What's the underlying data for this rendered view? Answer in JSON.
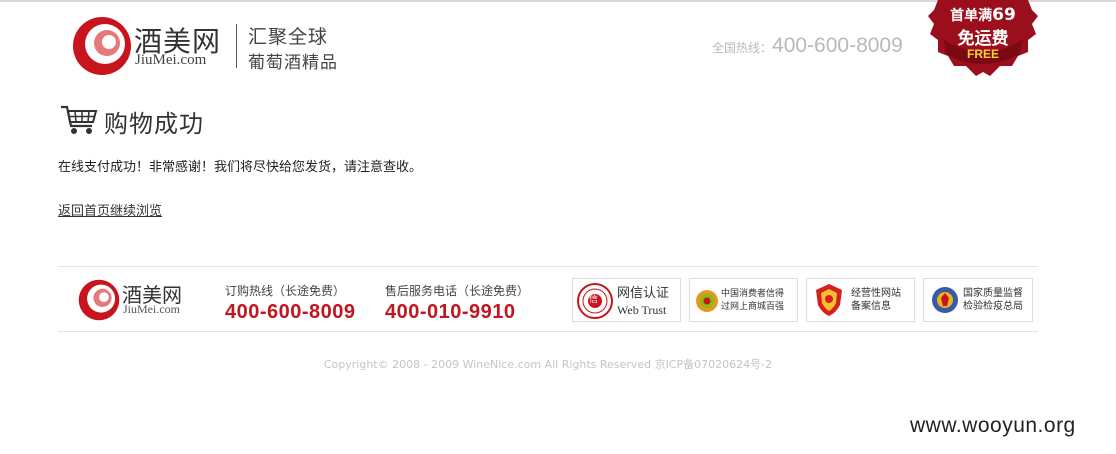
{
  "header": {
    "logo_cn": "酒美网",
    "logo_en": "JiuMei.com",
    "slogan_line1": "汇聚全球",
    "slogan_line2": "葡萄酒精品",
    "hotline_label": "全国热线：",
    "hotline_number": "400-600-8009",
    "badge": {
      "prefix": "首单满",
      "amount": "69",
      "line2": "免运费",
      "line3": "FREE"
    }
  },
  "main": {
    "title": "购物成功",
    "message": "在线支付成功！非常感谢！我们将尽快给您发货，请注意查收。",
    "back_link": "返回首页继续浏览"
  },
  "footer": {
    "logo_cn": "酒美网",
    "logo_en": "JiuMei.com",
    "order_hotline_label": "订购热线（长途免费）",
    "order_hotline_number": "400-600-8009",
    "service_hotline_label": "售后服务电话（长途免费）",
    "service_hotline_number": "400-010-9910",
    "certs": [
      {
        "line1": "网信认证",
        "line2": "Web Trust",
        "seal": "信"
      },
      {
        "line1": "中国消费者信得",
        "line2": "过网上商城百强"
      },
      {
        "line1": "经营性网站",
        "line2": "备案信息"
      },
      {
        "line1": "国家质量监督",
        "line2": "检验检疫总局"
      }
    ],
    "copyright": "Copyright© 2008 - 2009 WineNice.com All Rights Reserved  京ICP备07020624号-2"
  },
  "watermark": "www.wooyun.org",
  "colors": {
    "brand_red": "#c0161f",
    "badge_red": "#9b0e1c",
    "hotline_gray": "#b9b9b9"
  }
}
